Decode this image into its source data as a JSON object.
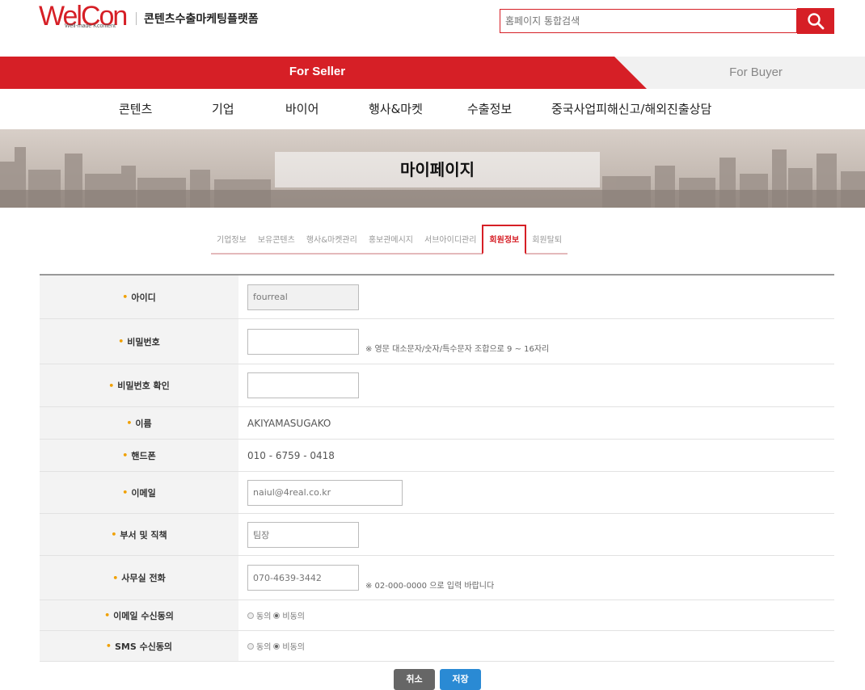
{
  "header": {
    "logo_text": "WelCon",
    "logo_sub": "Well-made Kcontent",
    "tagline": "콘텐츠수출마케팅플랫폼",
    "search_placeholder": "홈페이지 통합검색"
  },
  "role_bar": {
    "seller_label": "For Seller",
    "buyer_label": "For Buyer",
    "seller_color": "#d61f26",
    "buyer_color": "#f1f1f1"
  },
  "main_nav": [
    {
      "label": "콘텐츠"
    },
    {
      "label": "기업"
    },
    {
      "label": "바이어"
    },
    {
      "label": "행사&마켓"
    },
    {
      "label": "수출정보"
    },
    {
      "label": "중국사업피해신고/해외진출상담"
    }
  ],
  "banner": {
    "title": "마이페이지"
  },
  "sub_tabs": [
    {
      "label": "기업정보"
    },
    {
      "label": "보유콘텐츠"
    },
    {
      "label": "행사&마켓관리"
    },
    {
      "label": "홍보관메시지"
    },
    {
      "label": "서브아이디관리"
    },
    {
      "label": "회원정보",
      "active": true
    },
    {
      "label": "회원탈퇴"
    }
  ],
  "form": {
    "id_label": "아이디",
    "id_value": "fourreal",
    "password_label": "비밀번호",
    "password_hint": "※ 영문 대소문자/숫자/특수문자 조합으로 9 ~ 16자리",
    "password_confirm_label": "비밀번호 확인",
    "name_label": "이름",
    "name_value": "AKIYAMASUGAKO",
    "phone_label": "핸드폰",
    "phone_value": "010 - 6759 - 0418",
    "email_label": "이메일",
    "email_value": "naiul@4real.co.kr",
    "dept_label": "부서 및 직책",
    "dept_value": "팀장",
    "office_phone_label": "사무실 전화",
    "office_phone_value": "070-4639-3442",
    "office_phone_hint": "※ 02-000-0000 으로 입력 바랍니다",
    "email_consent_label": "이메일 수신동의",
    "sms_consent_label": "SMS 수신동의",
    "agree_label": "동의",
    "disagree_label": "비동의",
    "email_consent_value": "비동의",
    "sms_consent_value": "비동의"
  },
  "buttons": {
    "cancel": "취소",
    "save": "저장"
  },
  "colors": {
    "accent": "#d61f26",
    "save_button": "#2a8ad4",
    "cancel_button": "#666666"
  }
}
